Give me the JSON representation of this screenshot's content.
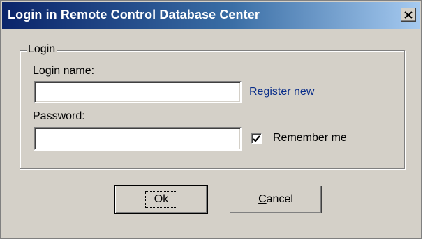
{
  "window": {
    "title": "Login in Remote Control Database Center",
    "close_icon": "close-x-icon"
  },
  "login_group": {
    "legend": "Login",
    "login_name_label": "Login name:",
    "login_name_value": "",
    "register_link": "Register new",
    "password_label": "Password:",
    "password_value": "",
    "remember_label": "Remember me",
    "remember_checked": true
  },
  "buttons": {
    "ok_label": "Ok",
    "cancel_label": "Cancel"
  },
  "colors": {
    "title_gradient_start": "#0a246a",
    "title_gradient_end": "#a6caf0",
    "dialog_face": "#d4d0c8",
    "link": "#0a2e8a"
  }
}
